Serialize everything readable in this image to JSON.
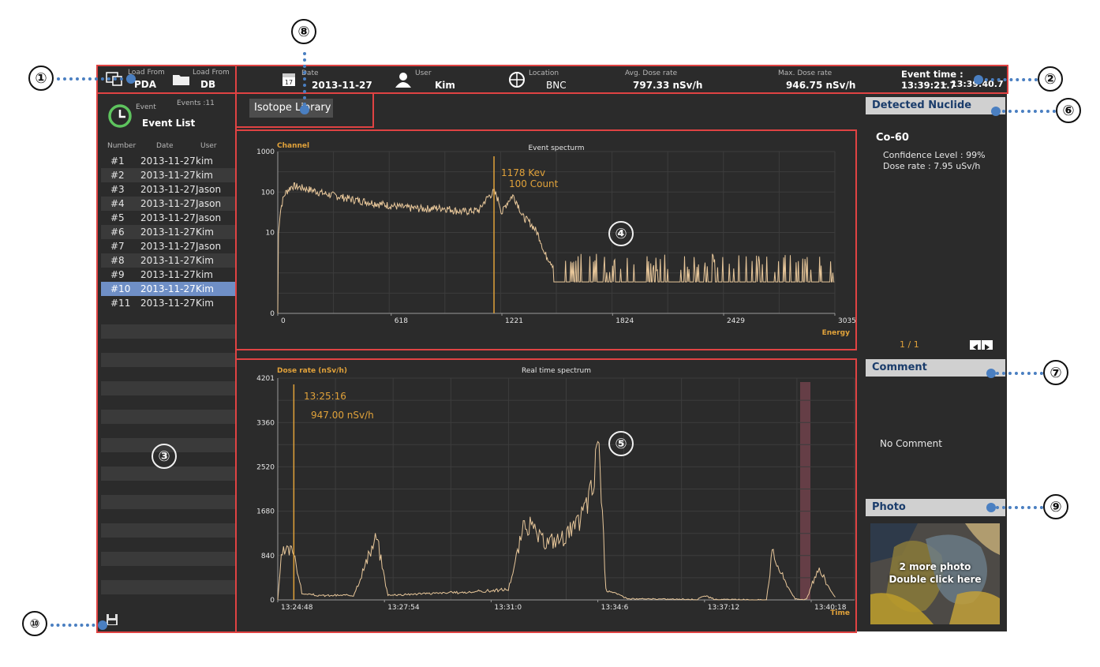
{
  "header": {
    "load_pda_label": "Load From",
    "load_pda_value": "PDA",
    "load_db_label": "Load From",
    "load_db_value": "DB",
    "date_label": "Date",
    "date_value": "2013-11-27",
    "calendar_day": "17",
    "user_label": "User",
    "user_value": "Kim",
    "location_label": "Location",
    "location_value": "BNC",
    "avg_label": "Avg. Dose rate",
    "avg_value": "797.33 nSv/h",
    "max_label": "Max. Dose rate",
    "max_value": "946.75 nSv/h",
    "event_time": "Event time : 13:39:21.7",
    "event_time_end": "~ 13:39:40.7"
  },
  "sidebar": {
    "event_small": "Event",
    "events_count": "Events :11",
    "title": "Event List",
    "columns": [
      "Number",
      "Date",
      "User"
    ],
    "rows": [
      {
        "num": "#1",
        "date": "2013-11-27",
        "user": "kim"
      },
      {
        "num": "#2",
        "date": "2013-11-27",
        "user": "kim"
      },
      {
        "num": "#3",
        "date": "2013-11-27",
        "user": "Jason"
      },
      {
        "num": "#4",
        "date": "2013-11-27",
        "user": "Jason"
      },
      {
        "num": "#5",
        "date": "2013-11-27",
        "user": "Jason"
      },
      {
        "num": "#6",
        "date": "2013-11-27",
        "user": "Kim"
      },
      {
        "num": "#7",
        "date": "2013-11-27",
        "user": "Jason"
      },
      {
        "num": "#8",
        "date": "2013-11-27",
        "user": "Kim"
      },
      {
        "num": "#9",
        "date": "2013-11-27",
        "user": "kim"
      },
      {
        "num": "#10",
        "date": "2013-11-27",
        "user": "Kim"
      },
      {
        "num": "#11",
        "date": "2013-11-27",
        "user": "Kim"
      }
    ],
    "selected_index": 9
  },
  "isotope_button": "Isotope Library",
  "event_chart": {
    "title": "Event specturm",
    "ylabel": "Channel",
    "xlabel": "Energy",
    "yticks": [
      "1000",
      "100",
      "10",
      "0"
    ],
    "xticks": [
      "0",
      "618",
      "1221",
      "1824",
      "2429",
      "3035"
    ],
    "cursor_line1": "1178 Kev",
    "cursor_line2": "100 Count"
  },
  "rt_chart": {
    "title": "Real time spectrum",
    "ylabel": "Dose rate (nSv/h)",
    "xlabel": "Time",
    "yticks": [
      "4201",
      "3360",
      "2520",
      "1680",
      "840",
      "0"
    ],
    "xticks": [
      "13:24:48",
      "13:27:54",
      "13:31:0",
      "13:34:6",
      "13:37:12",
      "13:40:18"
    ],
    "cursor_line1": "13:25:16",
    "cursor_line2": "947.00 nSv/h"
  },
  "chart_data": [
    {
      "type": "line",
      "title": "Event specturm",
      "xlabel": "Energy",
      "ylabel": "Channel",
      "yscale": "log",
      "xlim": [
        0,
        3035
      ],
      "ylim": [
        0,
        1000
      ],
      "cursor": {
        "energy_kev": 1178,
        "count": 100
      },
      "series": [
        {
          "x": [
            0,
            40,
            80,
            150,
            250,
            400,
            550,
            700,
            800,
            900,
            1000,
            1100,
            1178,
            1221,
            1280,
            1330,
            1400,
            1450,
            1500,
            1560,
            1650,
            1800,
            2000,
            2200,
            2400,
            2500,
            2600,
            3035
          ],
          "y": [
            0,
            90,
            140,
            120,
            90,
            65,
            50,
            40,
            38,
            40,
            32,
            35,
            100,
            28,
            80,
            25,
            12,
            3,
            1.5,
            1,
            0.8,
            0.6,
            0.6,
            0.6,
            0.6,
            0.8,
            0.5,
            0
          ]
        }
      ]
    },
    {
      "type": "line",
      "title": "Real time spectrum",
      "xlabel": "Time",
      "ylabel": "Dose rate (nSv/h)",
      "ylim": [
        0,
        4201
      ],
      "cursor": {
        "time": "13:25:16",
        "dose_rate": 947.0
      },
      "series": [
        {
          "x": [
            "13:24:48",
            "13:24:55",
            "13:25:16",
            "13:25:30",
            "13:26:00",
            "13:27:00",
            "13:27:40",
            "13:28:00",
            "13:29:00",
            "13:30:30",
            "13:31:30",
            "13:32:00",
            "13:32:30",
            "13:33:00",
            "13:33:30",
            "13:34:00",
            "13:34:06",
            "13:34:20",
            "13:35:00",
            "13:37:00",
            "13:37:12",
            "13:37:30",
            "13:39:00",
            "13:39:10",
            "13:39:30",
            "13:39:50",
            "13:40:10",
            "13:40:30",
            "13:41:00"
          ],
          "y": [
            0,
            880,
            947,
            120,
            80,
            90,
            1200,
            90,
            120,
            150,
            200,
            1500,
            1100,
            1150,
            1400,
            2200,
            3400,
            200,
            20,
            10,
            80,
            10,
            0,
            900,
            400,
            20,
            10,
            600,
            40
          ]
        }
      ]
    }
  ],
  "right": {
    "detected_header": "Detected Nuclide",
    "nuclide": "Co-60",
    "confidence": "Confidence Level : 99%",
    "dose_rate": "Dose rate : 7.95 uSv/h",
    "pager": "1 / 1",
    "comment_header": "Comment",
    "comment_text": "No Comment",
    "photo_header": "Photo",
    "photo_line1": "2 more photo",
    "photo_line2": "Double click here"
  },
  "markers": [
    "①",
    "②",
    "③",
    "④",
    "⑤",
    "⑥",
    "⑦",
    "⑧",
    "⑨",
    "⑩"
  ],
  "colors": {
    "accent_orange": "#e1a23a",
    "highlight_red": "#e04343",
    "callout_blue": "#4a7fc1",
    "selection_blue": "#6f8fc6"
  }
}
